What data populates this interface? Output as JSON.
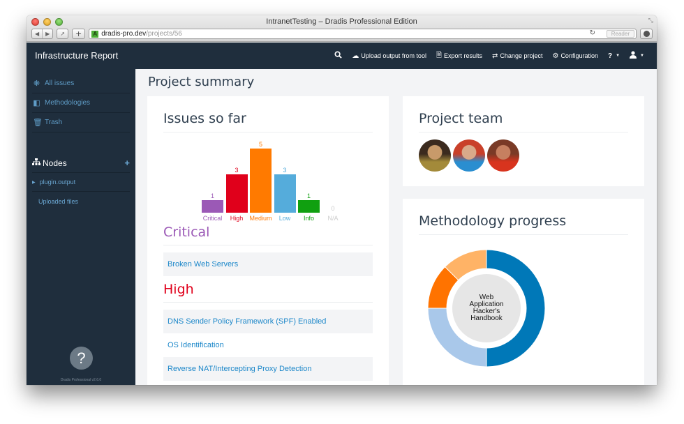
{
  "browser": {
    "window_title": "IntranetTesting – Dradis Professional Edition",
    "url_host": "dradis-pro.dev",
    "url_path": "/projects/56",
    "reader_label": "Reader",
    "favicon_letter": "A"
  },
  "navbar": {
    "brand": "Infrastructure Report",
    "items": [
      {
        "icon": "search-icon",
        "label": ""
      },
      {
        "icon": "cloud-upload-icon",
        "label": "Upload output from tool"
      },
      {
        "icon": "file-icon",
        "label": "Export results"
      },
      {
        "icon": "shuffle-icon",
        "label": "Change project"
      },
      {
        "icon": "gear-icon",
        "label": "Configuration"
      },
      {
        "icon": "question-icon",
        "label": "?"
      },
      {
        "icon": "user-icon",
        "label": ""
      }
    ]
  },
  "sidebar": {
    "links": [
      {
        "icon": "bug-icon",
        "label": "All issues"
      },
      {
        "icon": "board-icon",
        "label": "Methodologies"
      },
      {
        "icon": "trash-icon",
        "label": "Trash"
      }
    ],
    "nodes_label": "Nodes",
    "nodes": [
      {
        "label": "plugin.output",
        "expandable": true
      },
      {
        "label": "Uploaded files",
        "expandable": false
      }
    ],
    "help_glyph": "?",
    "version": "Dradis Professional v2.6.0"
  },
  "main": {
    "title": "Project summary",
    "issues_card": {
      "title": "Issues so far",
      "sections": [
        {
          "severity": "Critical",
          "color": "#9b59b6",
          "issues": [
            "Broken Web Servers"
          ]
        },
        {
          "severity": "High",
          "color": "#e0001b",
          "issues": [
            "DNS Sender Policy Framework (SPF) Enabled",
            "OS Identification",
            "Reverse NAT/Intercepting Proxy Detection"
          ]
        }
      ]
    },
    "team_card": {
      "title": "Project team",
      "members": [
        {
          "name": "avatar-1",
          "colors": [
            "#3b2a1e",
            "#c89a6a",
            "#a38a3a"
          ]
        },
        {
          "name": "avatar-2",
          "colors": [
            "#c9402a",
            "#d9a98a",
            "#2a8ed0"
          ]
        },
        {
          "name": "avatar-3",
          "colors": [
            "#7a3a26",
            "#c68060",
            "#d8341e"
          ]
        }
      ]
    },
    "methodology_card": {
      "title": "Methodology progress",
      "center_label": "Web Application Hacker's Handbook"
    }
  },
  "chart_data": [
    {
      "type": "bar",
      "title": "Issues so far",
      "categories": [
        "Critical",
        "High",
        "Medium",
        "Low",
        "Info",
        "N/A"
      ],
      "values": [
        1,
        3,
        5,
        3,
        1,
        0
      ],
      "colors": [
        "#9b59b6",
        "#e0001b",
        "#ff7a00",
        "#55acdb",
        "#10a010",
        "#cccccc"
      ],
      "xlabel": "",
      "ylabel": "",
      "ylim": [
        0,
        5
      ]
    },
    {
      "type": "pie",
      "title": "Methodology progress",
      "center_label": "Web Application Hacker's Handbook",
      "slices": [
        {
          "value": 50,
          "color": "#0078b8"
        },
        {
          "value": 25,
          "color": "#a9c8ea"
        },
        {
          "value": 12.5,
          "color": "#ff7300"
        },
        {
          "value": 12.5,
          "color": "#ffb366"
        }
      ]
    }
  ]
}
